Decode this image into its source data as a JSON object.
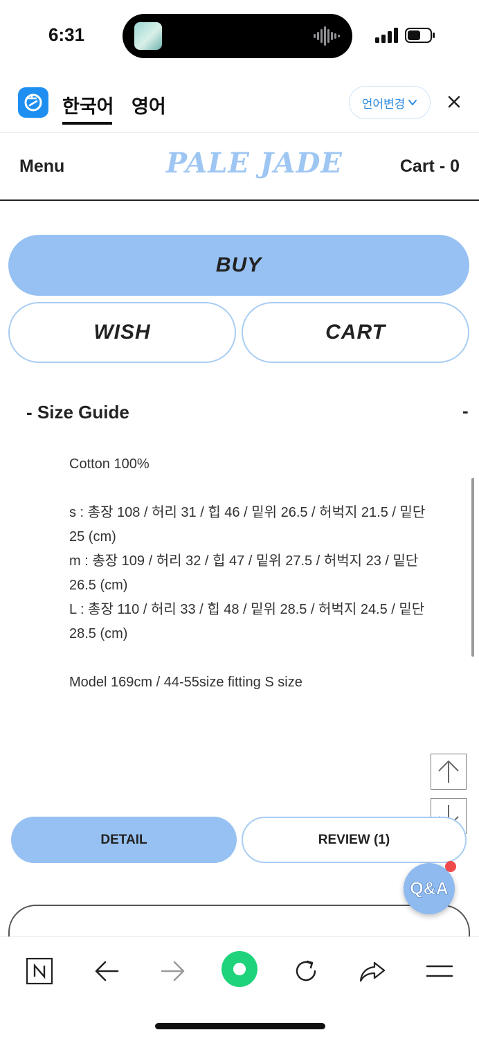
{
  "status_bar": {
    "time": "6:31"
  },
  "translate_bar": {
    "tab_korean": "한국어",
    "tab_english": "영어",
    "change_language": "언어변경"
  },
  "header": {
    "menu": "Menu",
    "logo": "PALE JADE",
    "cart": "Cart - 0"
  },
  "actions": {
    "buy": "BUY",
    "wish": "WISH",
    "cart": "CART"
  },
  "size_guide": {
    "title": "- Size Guide",
    "collapse": "-",
    "material": "Cotton 100%",
    "sizes": [
      "s : 총장 108 / 허리 31 / 힙 46 / 밑위 26.5 / 허벅지 21.5 / 밑단 25 (cm)",
      "m : 총장 109 / 허리 32 / 힙 47 / 밑위 27.5 / 허벅지 23 / 밑단 26.5 (cm)",
      "L : 총장 110 / 허리 33 / 힙 48 / 밑위 28.5 / 허벅지 24.5 / 밑단 28.5 (cm)"
    ],
    "model": "Model 169cm / 44-55size fitting S size"
  },
  "tabs": {
    "detail": "DETAIL",
    "review": "REVIEW (1)"
  },
  "qa_button": "Q&A",
  "colors": {
    "accent": "#97c1f2",
    "outline": "#a9cdf3",
    "logo": "#9ec6f3",
    "translate_blue": "#1e8ff0",
    "record_green": "#1fd37b",
    "notification": "#ef4b4b"
  },
  "icons": [
    "translate-logo-icon",
    "chevron-down-icon",
    "close-icon",
    "arrow-up-icon",
    "arrow-down-icon",
    "naver-n-icon",
    "back-arrow-icon",
    "forward-arrow-icon",
    "green-dot-icon",
    "reload-icon",
    "share-icon",
    "menu-icon"
  ]
}
